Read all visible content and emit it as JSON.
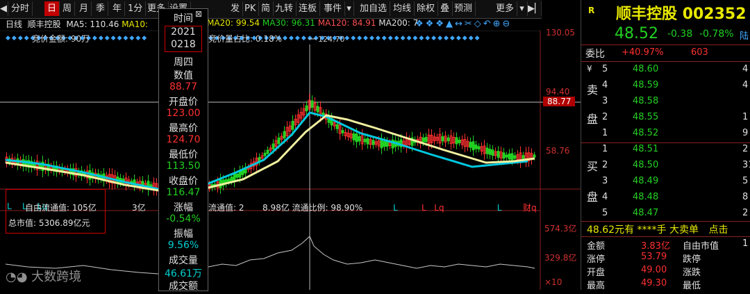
{
  "toolbar": {
    "items": [
      "分时",
      "日",
      "周",
      "月",
      "季",
      "年",
      "1分",
      "更多",
      "设置"
    ],
    "right_items": [
      "发",
      "PK",
      "简",
      "九转",
      "连板",
      "事件",
      "加自选",
      "均线",
      "除权",
      "叠",
      "预测",
      "更多"
    ]
  },
  "ma_line": {
    "mode": "日线",
    "stock": "顺丰控股",
    "ma5": "MA5: 110.46",
    "ma10": "MA10:",
    "ma20": "MA20: 99.54",
    "ma30": "MA30: 96.31",
    "ma120": "MA120: 84.91",
    "ma200": "MA200: 7"
  },
  "sub_labels": {
    "left": "竞价金额: 90万",
    "right": "竞价量占比: 0.18%",
    "peak": "124.70"
  },
  "price_axis": {
    "top": "130.05",
    "mid": "94.40",
    "cursor": "88.77",
    "low": "58.76"
  },
  "markers": {
    "row": [
      "L",
      "L",
      "Lq",
      "L",
      "L",
      "Lq",
      "L",
      "财q"
    ],
    "free_float": "自由流通值: 105亿",
    "free_float2": "3亿",
    "float_val": "流通值: 2",
    "float_val2": "8.98亿  流通比例: 98.90%",
    "total_mv": "总市值: 5306.89亿元"
  },
  "volume_axis": {
    "top": "574.3亿",
    "mid": "329.8亿",
    "unit": "×10"
  },
  "watermark": "大数跨境",
  "tooltip": {
    "time_label": "时间",
    "year": "2021",
    "date": "0218",
    "weekday": "周四",
    "value_label": "数值",
    "value": "88.77",
    "open_label": "开盘价",
    "open": "123.00",
    "high_label": "最高价",
    "high": "124.70",
    "low_label": "最低价",
    "low": "113.50",
    "close_label": "收盘价",
    "close": "116.47",
    "change_label": "涨幅",
    "change": "-0.54%",
    "amp_label": "振幅",
    "amp": "9.56%",
    "vol_label": "成交量",
    "vol": "46.61万",
    "amt_label": "成交额"
  },
  "quote": {
    "flag": "R",
    "name": "顺丰控股",
    "code": "002352",
    "price": "48.52",
    "change": "-0.38",
    "pct": "-0.78%",
    "tag": "陆",
    "ratio_label": "委比",
    "ratio": "+40.97%",
    "ratio_vol": "603"
  },
  "orderbook": {
    "sell_side_label": [
      "¥",
      "卖",
      "盘"
    ],
    "buy_side_label": [
      "买",
      "盘"
    ],
    "sell": [
      {
        "level": "5",
        "price": "48.60",
        "vol": "4"
      },
      {
        "level": "4",
        "price": "48.59",
        "vol": "4"
      },
      {
        "level": "3",
        "price": "48.58",
        "vol": ""
      },
      {
        "level": "2",
        "price": "48.55",
        "vol": "1"
      },
      {
        "level": "1",
        "price": "48.52",
        "vol": "9"
      }
    ],
    "buy": [
      {
        "level": "1",
        "price": "48.51",
        "vol": "2"
      },
      {
        "level": "2",
        "price": "48.50",
        "vol": "31"
      },
      {
        "level": "3",
        "price": "48.49",
        "vol": "5"
      },
      {
        "level": "4",
        "price": "48.48",
        "vol": "8"
      },
      {
        "level": "5",
        "price": "48.47",
        "vol": "2"
      }
    ]
  },
  "trade_bar": {
    "price": "48.62元有",
    "stars": "****手",
    "type": "大卖单",
    "tail": "点击"
  },
  "stats": [
    {
      "l1": "金额",
      "v1": "3.83亿",
      "l2": "自由市值",
      "v2": "1"
    },
    {
      "l1": "涨停",
      "v1": "53.79",
      "l2": "跌停",
      "v2": ""
    },
    {
      "l1": "开盘",
      "v1": "49.00",
      "l2": "涨跌",
      "v2": ""
    },
    {
      "l1": "最高",
      "v1": "49.30",
      "l2": "最低",
      "v2": ""
    }
  ],
  "colors": {
    "up": "#ff3030",
    "down": "#22d022",
    "ma_cyan": "#00c8e0",
    "ma_yellow": "#f0f0a0",
    "accent_red": "#c00000"
  }
}
